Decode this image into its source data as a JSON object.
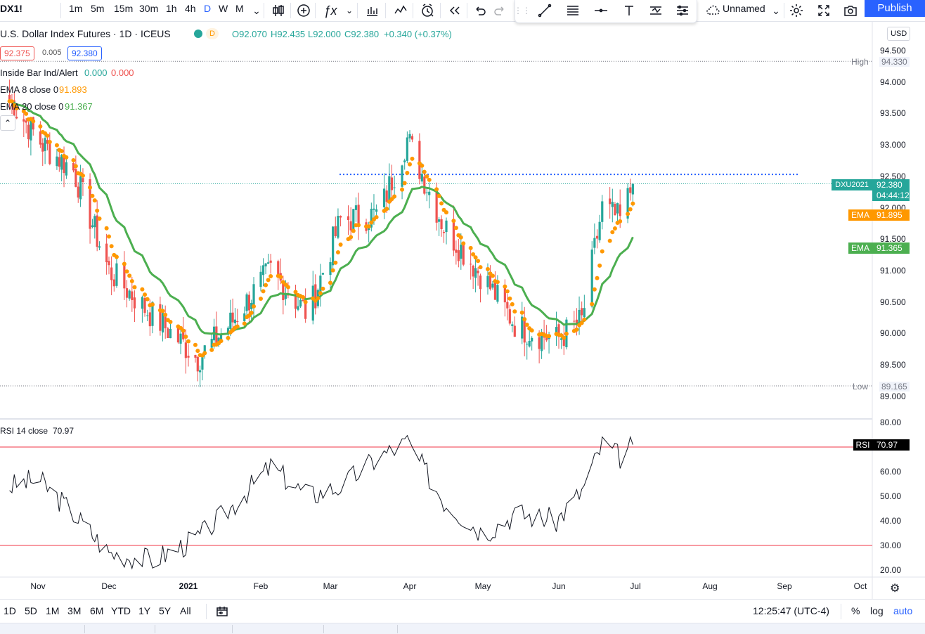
{
  "header": {
    "symbol": "DX1!",
    "intervals": [
      "1m",
      "5m",
      "15m",
      "30m",
      "1h",
      "4h",
      "D",
      "W",
      "M"
    ],
    "active_interval": "D",
    "layout_name": "Unnamed",
    "publish_label": "Publish"
  },
  "legend": {
    "title": "U.S. Dollar Index Futures · 1D · ICEUS",
    "badge": "D",
    "ohlc": {
      "o": "O92.070",
      "h": "H92.435",
      "l": "L92.000",
      "c": "C92.380",
      "chg": "+0.340 (+0.37%)"
    },
    "bid": "92.375",
    "spread": "0.005",
    "ask": "92.380",
    "indicators": [
      {
        "name": "Inside Bar Ind/Alert",
        "v1": "0.000",
        "v2": "0.000"
      },
      {
        "name": "EMA 8 close 0",
        "v1": "91.893"
      },
      {
        "name": "EMA 20 close 0",
        "v1": "91.367"
      }
    ],
    "rsi_title": "RSI 14 close",
    "rsi_value": "70.97"
  },
  "price_axis": {
    "currency": "USD",
    "labels": [
      "94.500",
      "94.000",
      "93.500",
      "93.000",
      "92.500",
      "92.000",
      "91.500",
      "91.000",
      "90.500",
      "90.000",
      "89.500",
      "89.000"
    ],
    "high_label": "High",
    "high_value": "94.330",
    "low_label": "Low",
    "low_value": "89.165",
    "last_symbol": "DXU2021",
    "last_value": "92.380",
    "countdown": "04:44:12",
    "ema_label": "EMA",
    "ema8_value": "91.895",
    "ema20_value": "91.365"
  },
  "rsi_axis": {
    "labels": [
      "80.00",
      "70.00",
      "60.00",
      "50.00",
      "40.00",
      "30.00",
      "20.00"
    ],
    "tag_label": "RSI",
    "tag_value": "70.97"
  },
  "time_axis": {
    "labels": [
      "Nov",
      "Dec",
      "2021",
      "Feb",
      "Mar",
      "Apr",
      "May",
      "Jun",
      "Jul",
      "Aug",
      "Sep",
      "Oct"
    ]
  },
  "bottom": {
    "ranges": [
      "1D",
      "5D",
      "1M",
      "3M",
      "6M",
      "YTD",
      "1Y",
      "5Y",
      "All"
    ],
    "clock": "12:25:47 (UTC-4)",
    "percent": "%",
    "log": "log",
    "auto": "auto"
  },
  "colors": {
    "up": "#26a69a",
    "down": "#ef5350",
    "ema8": "#ff9800",
    "ema20": "#4caf50",
    "accent": "#2962ff",
    "rsi_line": "#131722",
    "rsi_bands": "#f23645"
  },
  "chart_data": {
    "type": "candlestick",
    "symbol": "DXU2021",
    "timeframe": "1D",
    "ylim": [
      88.9,
      94.6
    ],
    "close_series": {
      "dates": [
        "2020-10-20",
        "2020-11-03",
        "2020-11-16",
        "2020-12-01",
        "2020-12-15",
        "2021-01-05",
        "2021-01-20",
        "2021-02-05",
        "2021-02-20",
        "2021-03-05",
        "2021-03-20",
        "2021-03-31",
        "2021-04-15",
        "2021-05-01",
        "2021-05-15",
        "2021-05-31",
        "2021-06-10",
        "2021-06-18",
        "2021-06-25",
        "2021-06-30"
      ],
      "close": [
        93.7,
        93.0,
        92.6,
        91.0,
        90.4,
        89.6,
        90.2,
        91.0,
        90.3,
        91.8,
        91.9,
        93.1,
        91.7,
        90.9,
        90.1,
        89.9,
        90.2,
        92.0,
        91.8,
        92.38
      ]
    },
    "ema8": {
      "last": 91.893
    },
    "ema20": {
      "last": 91.367
    },
    "high": 94.33,
    "low": 89.165,
    "horizontal_line": 92.53,
    "rsi": {
      "period": 14,
      "bands": [
        70,
        30
      ],
      "ylim": [
        20,
        80
      ],
      "dates": [
        "2020-10-20",
        "2020-11-01",
        "2020-11-15",
        "2020-12-01",
        "2020-12-18",
        "2021-01-05",
        "2021-01-20",
        "2021-02-05",
        "2021-02-20",
        "2021-03-05",
        "2021-03-20",
        "2021-03-31",
        "2021-04-15",
        "2021-05-01",
        "2021-05-15",
        "2021-05-31",
        "2021-06-10",
        "2021-06-18",
        "2021-06-25",
        "2021-06-30"
      ],
      "values": [
        54,
        57,
        44,
        27,
        24,
        33,
        46,
        62,
        50,
        54,
        66,
        72,
        48,
        35,
        43,
        40,
        52,
        71,
        66,
        70.97
      ]
    }
  }
}
